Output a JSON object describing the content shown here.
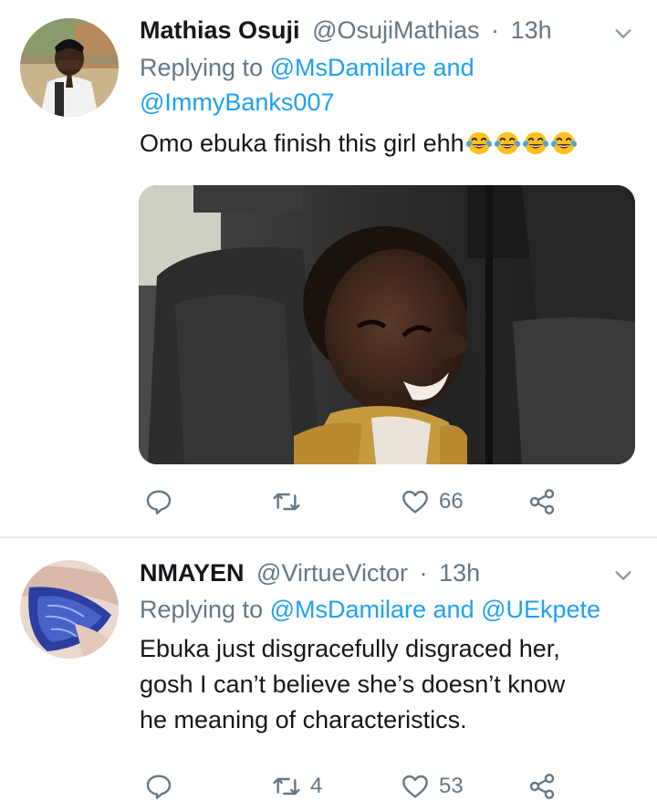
{
  "tweets": [
    {
      "name": "Mathias Osuji",
      "handle": "@OsujiMathias",
      "time": "13h",
      "replying_prefix": "Replying to",
      "replying_line1": "@MsDamilare and",
      "replying_line2": "@ImmyBanks007",
      "text": "Omo ebuka finish this girl ehh",
      "emoji": [
        "face-with-tears-of-joy",
        "face-with-tears-of-joy",
        "face-with-tears-of-joy",
        "face-with-tears-of-joy"
      ],
      "counts": {
        "reply": "",
        "retweet": "",
        "like": "66"
      }
    },
    {
      "name": "NMAYEN",
      "handle": "@VirtueVictor",
      "time": "13h",
      "replying_prefix": "Replying to",
      "replying_line1": "@MsDamilare and @UEkpete",
      "body_lines": [
        "Ebuka just disgracefully disgraced her,",
        "gosh I can’t believe she’s doesn’t know",
        "he meaning of characteristics."
      ],
      "counts": {
        "reply": "",
        "retweet": "4",
        "like": "53"
      }
    }
  ],
  "separator": "·",
  "colors": {
    "name": "#14171a",
    "secondary": "#657786",
    "link": "#1da1f2",
    "divider": "#e6ecf0"
  }
}
